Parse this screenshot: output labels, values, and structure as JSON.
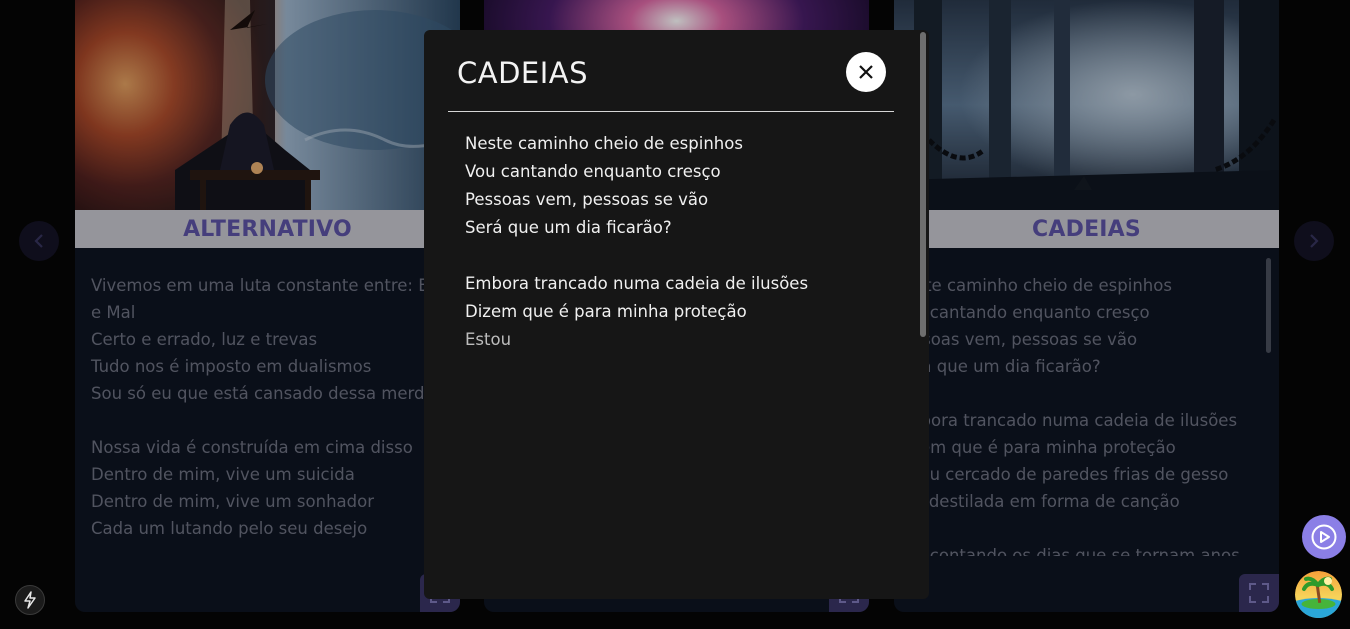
{
  "cards": [
    {
      "title": "ALTERNATIVO",
      "lines": [
        "Vivemos em uma luta constante entre: Bem",
        "e Mal",
        "Certo e errado, luz e trevas",
        "Tudo nos é imposto em dualismos",
        "Sou só eu que está cansado dessa merda?",
        "",
        "Nossa vida é construída em cima disso",
        "Dentro de mim, vive um suicida",
        "Dentro de mim, vive um sonhador",
        "Cada um lutando pelo seu desejo"
      ]
    },
    {
      "title": "CADEIAS",
      "lines": [
        "Neste caminho cheio de espinhos",
        "Vou cantando enquanto cresço",
        "Pessoas vem, pessoas se vão",
        "Será que um dia ficarão?",
        "",
        "Embora trancado numa cadeia de ilusões",
        "Dizem que é para minha proteção",
        "Estou cercado de paredes frias de gesso",
        "Dor destilada em forma de canção",
        "",
        "Vou contando os dias que se tornam anos"
      ]
    }
  ],
  "modal": {
    "title": "CADEIAS",
    "lines": [
      "Neste caminho cheio de espinhos",
      "Vou cantando enquanto cresço",
      "Pessoas vem, pessoas se vão",
      "Será que um dia ficarão?",
      "",
      "Embora trancado numa cadeia de ilusões",
      "Dizem que é para minha proteção",
      "Estou"
    ]
  },
  "colors": {
    "accent": "#8b7fe6",
    "card_title": "#5d53a6",
    "modal_bg": "#161616"
  }
}
